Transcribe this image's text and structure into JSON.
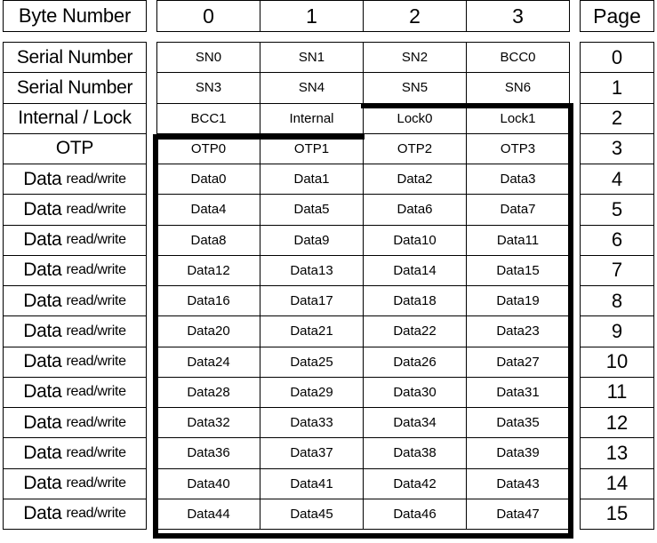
{
  "table": {
    "header": {
      "row_label": "Byte Number",
      "byte_columns": [
        "0",
        "1",
        "2",
        "3"
      ],
      "page_label": "Page"
    },
    "rows": [
      {
        "label": "Serial Number",
        "label_main": "Serial Number",
        "label_sub": "",
        "bytes": [
          "SN0",
          "SN1",
          "SN2",
          "BCC0"
        ],
        "page": "0"
      },
      {
        "label": "Serial Number",
        "label_main": "Serial Number",
        "label_sub": "",
        "bytes": [
          "SN3",
          "SN4",
          "SN5",
          "SN6"
        ],
        "page": "1"
      },
      {
        "label": "Internal / Lock",
        "label_main": "Internal / Lock",
        "label_sub": "",
        "bytes": [
          "BCC1",
          "Internal",
          "Lock0",
          "Lock1"
        ],
        "page": "2"
      },
      {
        "label": "OTP",
        "label_main": "OTP",
        "label_sub": "",
        "bytes": [
          "OTP0",
          "OTP1",
          "OTP2",
          "OTP3"
        ],
        "page": "3"
      },
      {
        "label": "Data read/write",
        "label_main": "Data",
        "label_sub": "read/write",
        "bytes": [
          "Data0",
          "Data1",
          "Data2",
          "Data3"
        ],
        "page": "4"
      },
      {
        "label": "Data read/write",
        "label_main": "Data",
        "label_sub": "read/write",
        "bytes": [
          "Data4",
          "Data5",
          "Data6",
          "Data7"
        ],
        "page": "5"
      },
      {
        "label": "Data read/write",
        "label_main": "Data",
        "label_sub": "read/write",
        "bytes": [
          "Data8",
          "Data9",
          "Data10",
          "Data11"
        ],
        "page": "6"
      },
      {
        "label": "Data read/write",
        "label_main": "Data",
        "label_sub": "read/write",
        "bytes": [
          "Data12",
          "Data13",
          "Data14",
          "Data15"
        ],
        "page": "7"
      },
      {
        "label": "Data read/write",
        "label_main": "Data",
        "label_sub": "read/write",
        "bytes": [
          "Data16",
          "Data17",
          "Data18",
          "Data19"
        ],
        "page": "8"
      },
      {
        "label": "Data read/write",
        "label_main": "Data",
        "label_sub": "read/write",
        "bytes": [
          "Data20",
          "Data21",
          "Data22",
          "Data23"
        ],
        "page": "9"
      },
      {
        "label": "Data read/write",
        "label_main": "Data",
        "label_sub": "read/write",
        "bytes": [
          "Data24",
          "Data25",
          "Data26",
          "Data27"
        ],
        "page": "10"
      },
      {
        "label": "Data read/write",
        "label_main": "Data",
        "label_sub": "read/write",
        "bytes": [
          "Data28",
          "Data29",
          "Data30",
          "Data31"
        ],
        "page": "11"
      },
      {
        "label": "Data read/write",
        "label_main": "Data",
        "label_sub": "read/write",
        "bytes": [
          "Data32",
          "Data33",
          "Data34",
          "Data35"
        ],
        "page": "12"
      },
      {
        "label": "Data read/write",
        "label_main": "Data",
        "label_sub": "read/write",
        "bytes": [
          "Data36",
          "Data37",
          "Data38",
          "Data39"
        ],
        "page": "13"
      },
      {
        "label": "Data read/write",
        "label_main": "Data",
        "label_sub": "read/write",
        "bytes": [
          "Data40",
          "Data41",
          "Data42",
          "Data43"
        ],
        "page": "14"
      },
      {
        "label": "Data read/write",
        "label_main": "Data",
        "label_sub": "read/write",
        "bytes": [
          "Data44",
          "Data45",
          "Data46",
          "Data47"
        ],
        "page": "15"
      }
    ]
  },
  "colors": {
    "background": "#ffffff",
    "text": "#000000",
    "grid_line": "#000000",
    "highlight_outline": "#000000"
  }
}
